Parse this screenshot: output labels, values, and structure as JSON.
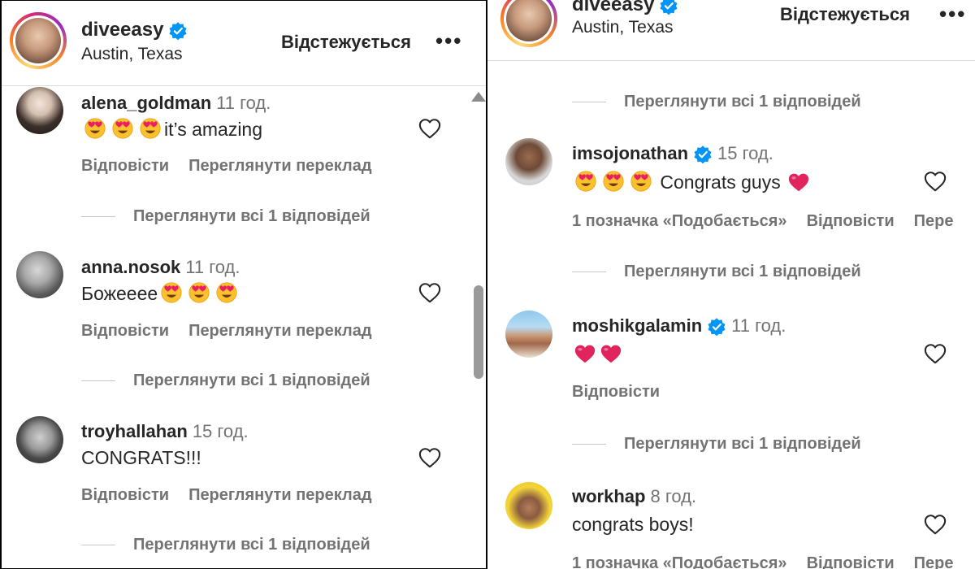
{
  "left": {
    "header": {
      "username": "diveeasy",
      "location": "Austin, Texas",
      "follow_label": "Відстежується",
      "more_label": "•••"
    },
    "comments": [
      {
        "username": "alena_goldman",
        "time": "11 год.",
        "text": "it’s amazing",
        "reply": "Відповісти",
        "translate": "Переглянути переклад",
        "replies": "Переглянути всі 1 відповідей"
      },
      {
        "username": "anna.nosok",
        "time": "11 год.",
        "text": "Божееее",
        "reply": "Відповісти",
        "translate": "Переглянути переклад",
        "replies": "Переглянути всі 1 відповідей"
      },
      {
        "username": "troyhallahan",
        "time": "15 год.",
        "text": "CONGRATS!!!",
        "reply": "Відповісти",
        "translate": "Переглянути переклад",
        "replies": "Переглянути всі 1 відповідей"
      }
    ]
  },
  "right": {
    "header": {
      "username": "diveeasy",
      "location": "Austin, Texas",
      "follow_label": "Відстежується",
      "more_label": "•••"
    },
    "top_replies": "Переглянути всі 1 відповідей",
    "comments": [
      {
        "username": "imsojonathan",
        "time": "15 год.",
        "text": "Congrats guys",
        "likes": "1 позначка «Подобається»",
        "reply": "Відповісти",
        "translate": "Пере",
        "replies": "Переглянути всі 1 відповідей"
      },
      {
        "username": "moshikgalamin",
        "time": "11 год.",
        "reply": "Відповісти",
        "replies": "Переглянути всі 1 відповідей"
      },
      {
        "username": "workhap",
        "time": "8 год.",
        "text": "congrats boys!",
        "likes": "1 позначка «Подобається»",
        "reply": "Відповісти",
        "translate": "Пере"
      }
    ]
  },
  "icons": {
    "verified": "verified-badge-icon",
    "heart": "heart-outline-icon",
    "emoji": "heart-eyes-emoji-icon",
    "red_heart": "red-heart-emoji-icon"
  },
  "colors": {
    "verified_blue": "#0095f6",
    "muted_text": "#737373",
    "red_heart": "#e0245e"
  }
}
